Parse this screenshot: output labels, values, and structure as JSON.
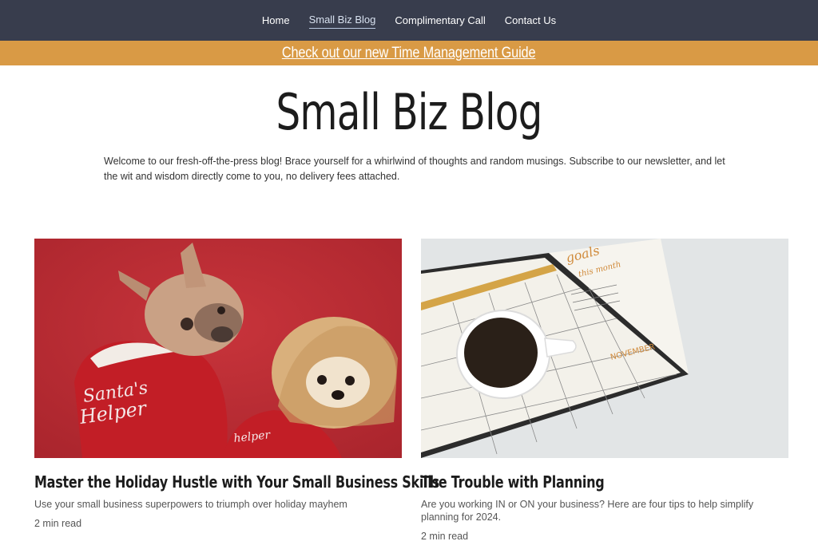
{
  "nav": {
    "items": [
      {
        "label": "Home"
      },
      {
        "label": "Small Biz Blog"
      },
      {
        "label": "Complimentary Call"
      },
      {
        "label": "Contact Us"
      }
    ]
  },
  "promo": {
    "label": "Check out our new Time Management Guide"
  },
  "page": {
    "title": "Small Biz Blog",
    "intro": "Welcome to our fresh-off-the-press blog! Brace yourself for a whirlwind of thoughts and random musings. Subscribe to our newsletter, and let the wit and wisdom directly come to you, no delivery fees attached."
  },
  "posts": [
    {
      "title": "Master the Holiday Hustle with Your Small Business Skills",
      "excerpt": "Use your small business superpowers to triumph over holiday mayhem",
      "read_time": "2 min read",
      "image_text": {
        "shirt1": "Santa's Helper",
        "shirt2": "Santa's Helper"
      }
    },
    {
      "title": "The Trouble with Planning",
      "excerpt": "Are you working IN or ON your business? Here are four tips to help simplify planning for 2024.",
      "read_time": "2 min read",
      "image_text": {
        "goals": "goals this month",
        "month": "NOVEMBER"
      }
    }
  ],
  "colors": {
    "nav_bg": "#383d4d",
    "promo_bg": "#d99a45"
  }
}
